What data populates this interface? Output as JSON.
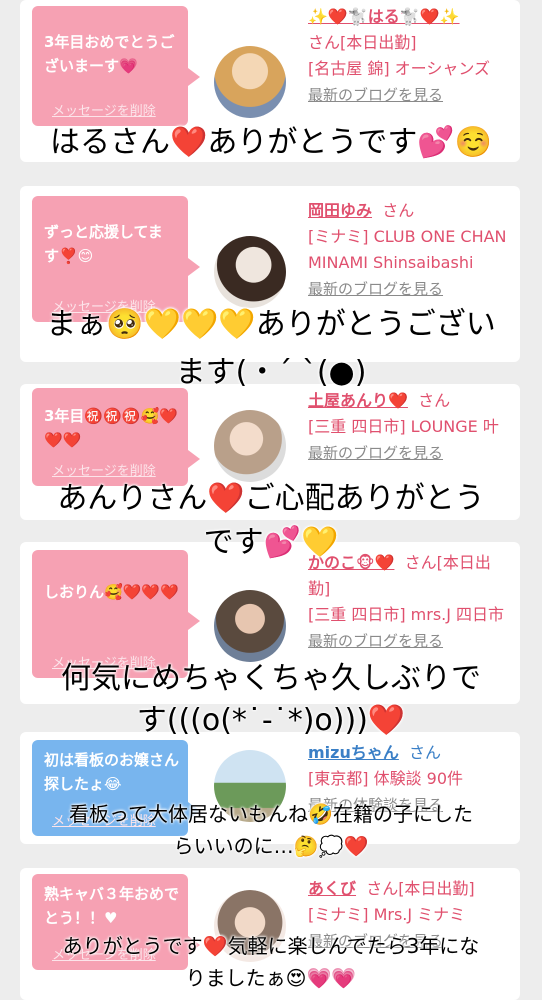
{
  "cards": [
    {
      "bubble": "3年目おめでとうございまーす💗",
      "delete": "メッセージを削除",
      "name": "✨❤️🐩はる🐩❤️✨",
      "san": "さん[本日出勤]",
      "location": "[名古屋 錦] オーシャンズ",
      "blog": "最新のブログを見る"
    },
    {
      "bubble": "ずっと応援してます❣️😊",
      "delete": "メッセージを削除",
      "name": "岡田ゆみ",
      "san": "さん",
      "location": "[ミナミ] CLUB ONE CHAN MINAMI Shinsaibashi",
      "blog": "最新のブログを見る"
    },
    {
      "bubble": "3年目㊗️㊗️㊗️🥰❤️❤️❤️",
      "delete": "メッセージを削除",
      "name": "土屋あんり❤️",
      "san": "さん",
      "location": "[三重 四日市] LOUNGE 叶",
      "blog": "最新のブログを見る"
    },
    {
      "bubble": "しおりん🥰❤️❤️❤️",
      "delete": "メッセージを削除",
      "name": "かのこ🐵❤️",
      "san": "さん[本日出勤]",
      "location": "[三重 四日市] mrs.J 四日市",
      "blog": "最新のブログを見る"
    },
    {
      "bubble": "初は看板のお嬢さん探したょ😂",
      "delete": "メッセージを削除",
      "name": "mizuちゃん",
      "san": "さん",
      "location": "[東京都] 体験談 90件",
      "blog": "最新の体験談を見る"
    },
    {
      "bubble": "熟キャバ３年おめでとう！！♥",
      "delete": "メッセージを削除",
      "name": "あくび",
      "san": "さん[本日出勤]",
      "location": "[ミナミ] Mrs.J ミナミ",
      "blog": "最新のブログを見る"
    }
  ],
  "overlays": [
    "はるさん❤️ありがとうです💕☺️",
    "まぁ🥺💛💛💛ありがとうござい",
    "ます(・´ `(●)",
    "あんりさん❤️ご心配ありがとう",
    "です💕💛",
    "何気にめちゃくちゃ久しぶりで",
    "す(((o(*˙-˙*)o)))❤️",
    "看板って大体居ないもんね🤣在籍の子にした",
    "らいいのに…🤔💭❤️",
    "ありがとうです❤️気軽に楽しんでたら3年にな",
    "りましたぁ😍💗💗"
  ],
  "colors": {
    "pink": "#f6a1b3",
    "blue": "#78b5ee",
    "name_pink": "#e0506e",
    "name_blue": "#3a7fc6"
  }
}
